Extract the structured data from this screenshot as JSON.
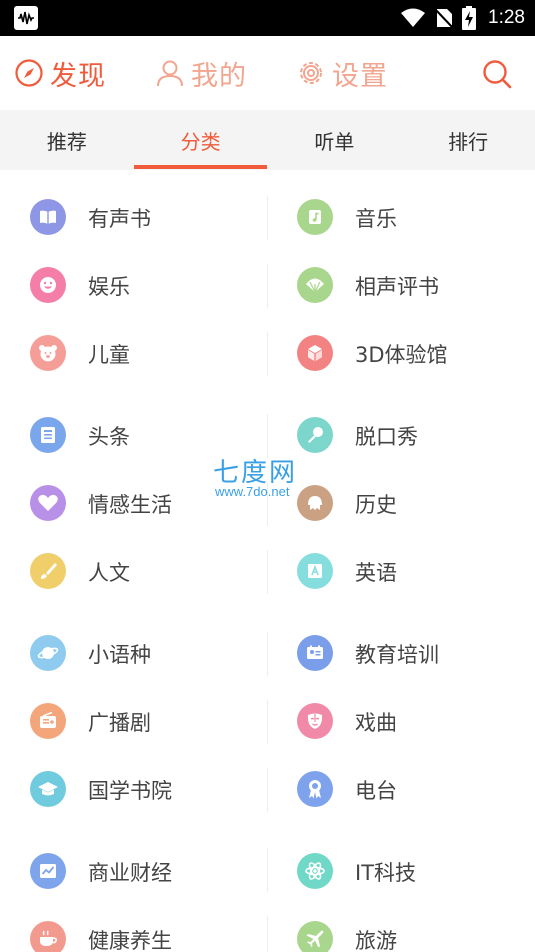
{
  "status_bar": {
    "time": "1:28",
    "icons": [
      "app-notification-icon",
      "wifi-icon",
      "no-sim-icon",
      "battery-charging-icon"
    ]
  },
  "top_nav": {
    "items": [
      {
        "label": "发现",
        "icon": "compass-icon",
        "active": true
      },
      {
        "label": "我的",
        "icon": "user-icon",
        "active": false
      },
      {
        "label": "设置",
        "icon": "gear-icon",
        "active": false
      }
    ],
    "search_icon": "search-icon"
  },
  "sub_tabs": {
    "items": [
      "推荐",
      "分类",
      "听单",
      "排行"
    ],
    "active_index": 1
  },
  "categories": [
    {
      "label": "有声书",
      "icon": "book-icon",
      "color": "#8e97e6"
    },
    {
      "label": "音乐",
      "icon": "music-note-icon",
      "color": "#a9d68d"
    },
    {
      "label": "娱乐",
      "icon": "smiley-icon",
      "color": "#f57ea9"
    },
    {
      "label": "相声评书",
      "icon": "fan-icon",
      "color": "#a9d68d"
    },
    {
      "label": "儿童",
      "icon": "bear-icon",
      "color": "#f59e98"
    },
    {
      "label": "3D体验馆",
      "icon": "cube-icon",
      "color": "#f38383"
    },
    {
      "label": "头条",
      "icon": "newspaper-icon",
      "color": "#7aa6ec"
    },
    {
      "label": "脱口秀",
      "icon": "microphone-icon",
      "color": "#7dd6cc"
    },
    {
      "label": "情感生活",
      "icon": "heart-icon",
      "color": "#b990e8"
    },
    {
      "label": "历史",
      "icon": "helmet-icon",
      "color": "#cba184"
    },
    {
      "label": "人文",
      "icon": "brush-icon",
      "color": "#f0cf6a"
    },
    {
      "label": "英语",
      "icon": "letter-a-icon",
      "color": "#85dedd"
    },
    {
      "label": "小语种",
      "icon": "planet-icon",
      "color": "#8ecbee"
    },
    {
      "label": "教育培训",
      "icon": "id-card-icon",
      "color": "#7b9eea"
    },
    {
      "label": "广播剧",
      "icon": "radio-icon",
      "color": "#f3a57b"
    },
    {
      "label": "戏曲",
      "icon": "opera-mask-icon",
      "color": "#f08aa8"
    },
    {
      "label": "国学书院",
      "icon": "graduation-cap-icon",
      "color": "#6fcbdd"
    },
    {
      "label": "电台",
      "icon": "award-ribbon-icon",
      "color": "#7ea3ec"
    },
    {
      "label": "商业财经",
      "icon": "chart-icon",
      "color": "#7ea5ec"
    },
    {
      "label": "IT科技",
      "icon": "atom-icon",
      "color": "#6fd8c6"
    },
    {
      "label": "健康养生",
      "icon": "teacup-icon",
      "color": "#f39a8f"
    },
    {
      "label": "旅游",
      "icon": "airplane-icon",
      "color": "#a9d68d"
    }
  ],
  "watermark": {
    "title": "七度网",
    "url": "www.7do.net"
  },
  "colors": {
    "accent": "#ef5b3b",
    "accent_light": "#f2a58f"
  }
}
